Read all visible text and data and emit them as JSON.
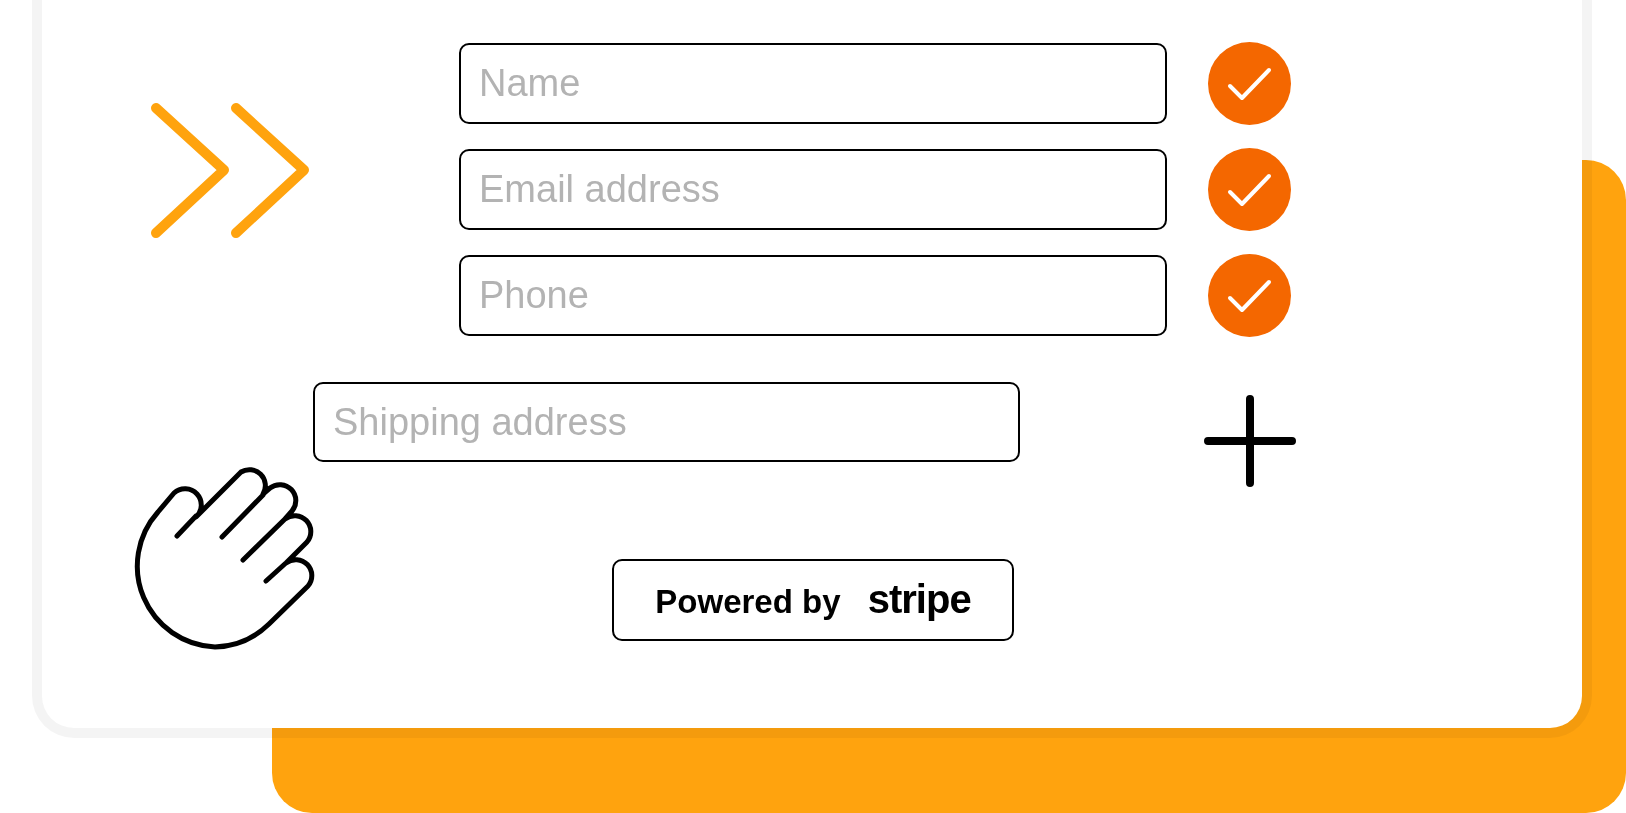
{
  "fields": [
    {
      "placeholder": "Name",
      "checked": true
    },
    {
      "placeholder": "Email address",
      "checked": true
    },
    {
      "placeholder": "Phone",
      "checked": true
    }
  ],
  "optional_field": {
    "placeholder": "Shipping address"
  },
  "badge": {
    "text": "Powered by **stripe**"
  }
}
